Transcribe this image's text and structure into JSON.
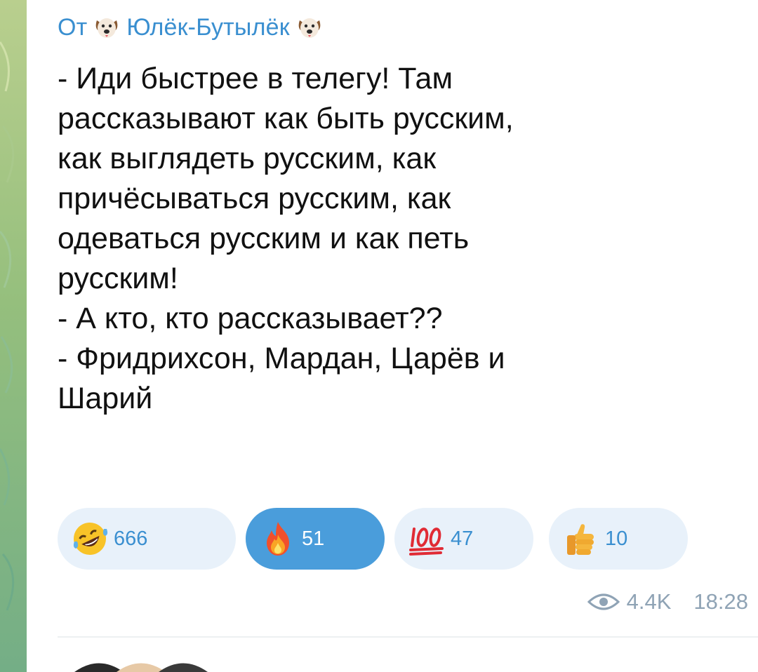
{
  "forward": {
    "prefix": "От",
    "channel_name": "Юлёк-Бутылёк",
    "icon": "dog-face-emoji"
  },
  "message": {
    "text": "- Иди быстрее в телегу! Там\nрассказывают как быть русским,\nкак выглядеть русским, как\nпричёсываться русским, как\nодеваться русским и как петь\nрусским!\n- А кто, кто рассказывает??\n- Фридрихсон, Мардан, Царёв и\nШарий"
  },
  "reactions": [
    {
      "emoji": "rolling-on-floor-laughing-emoji",
      "count": "666",
      "active": false
    },
    {
      "emoji": "fire-emoji",
      "count": "51",
      "active": true
    },
    {
      "emoji": "hundred-points-emoji",
      "count": "47",
      "active": false
    },
    {
      "emoji": "thumbs-up-emoji",
      "count": "10",
      "active": false
    }
  ],
  "meta": {
    "views": "4.4K",
    "time": "18:28",
    "views_icon": "eye-icon"
  },
  "colors": {
    "accent": "#3a8fd0",
    "reaction_bg": "#e8f1fa",
    "reaction_active_bg": "#4a9ddb",
    "meta_text": "#8fa3b5",
    "wallpaper": "#95bf7d"
  }
}
